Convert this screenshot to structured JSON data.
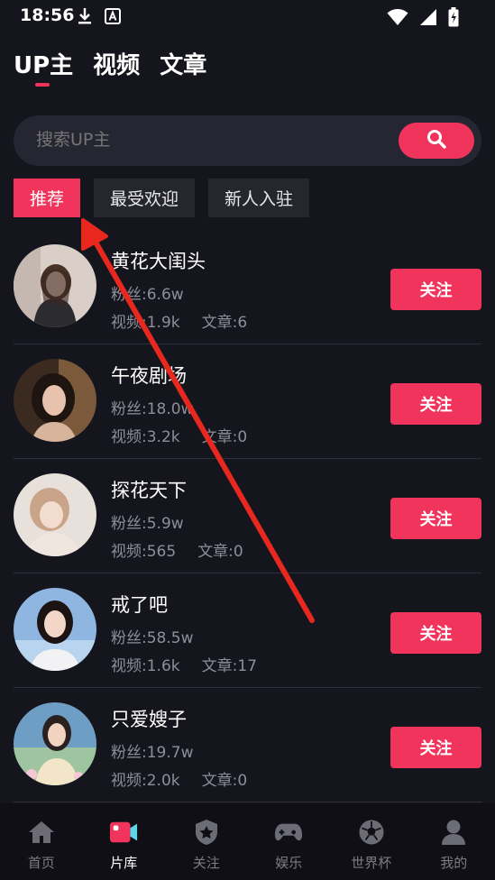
{
  "status_bar": {
    "time": "18:56"
  },
  "top_tabs": [
    "UP主",
    "视频",
    "文章"
  ],
  "search": {
    "placeholder": "搜索UP主"
  },
  "filters": [
    "推荐",
    "最受欢迎",
    "新人入驻"
  ],
  "creators": [
    {
      "name": "黄花大闺头",
      "fans": "粉丝:6.6w",
      "videos": "视频:1.9k",
      "articles": "文章:6",
      "follow": "关注"
    },
    {
      "name": "午夜剧场",
      "fans": "粉丝:18.0w",
      "videos": "视频:3.2k",
      "articles": "文章:0",
      "follow": "关注"
    },
    {
      "name": "探花天下",
      "fans": "粉丝:5.9w",
      "videos": "视频:565",
      "articles": "文章:0",
      "follow": "关注"
    },
    {
      "name": "戒了吧",
      "fans": "粉丝:58.5w",
      "videos": "视频:1.6k",
      "articles": "文章:17",
      "follow": "关注"
    },
    {
      "name": "只爱嫂子",
      "fans": "粉丝:19.7w",
      "videos": "视频:2.0k",
      "articles": "文章:0",
      "follow": "关注"
    }
  ],
  "bottom_nav": [
    {
      "label": "首页",
      "icon": "home-icon"
    },
    {
      "label": "片库",
      "icon": "video-library-icon",
      "active": true
    },
    {
      "label": "关注",
      "icon": "star-shield-icon"
    },
    {
      "label": "娱乐",
      "icon": "gamepad-icon"
    },
    {
      "label": "世界杯",
      "icon": "soccer-ball-icon"
    },
    {
      "label": "我的",
      "icon": "user-icon"
    }
  ],
  "colors": {
    "accent": "#f0345c",
    "background": "#15151d",
    "annotation_arrow": "#e8281e"
  }
}
